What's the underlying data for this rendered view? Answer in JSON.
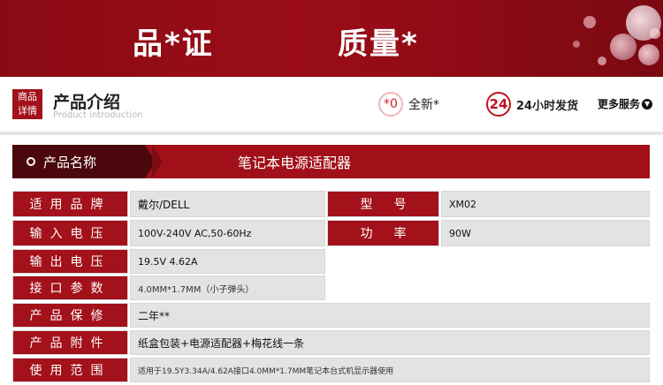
{
  "banner": {
    "left_text": "品*证",
    "right_text": "质量*"
  },
  "intro": {
    "badge_line1": "商品",
    "badge_line2": "详情",
    "title": "产品介绍",
    "subtitle": "Product introduction",
    "feature_new_icon": "*0",
    "feature_new_label": "全新*",
    "feature_ship_icon": "24",
    "feature_ship_label": "24小时发货",
    "more_label": "更多服务",
    "more_icon": "chevron-down-icon"
  },
  "product_name": {
    "label": "产品名称",
    "value": "笔记本电源适配器"
  },
  "specs": [
    {
      "label": "适用品牌",
      "value": "戴尔/DELL"
    },
    {
      "label": "输入电压",
      "value": "100V-240V AC,50-60Hz"
    },
    {
      "label": "输出电压",
      "value": "19.5V 4.62A"
    },
    {
      "label": "接口参数",
      "value": "4.0MM*1.7MM（小子弹头）"
    },
    {
      "label": "产品保修",
      "value": "二年**"
    },
    {
      "label": "产品附件",
      "value": "纸盒包装+电源适配器+梅花线一条"
    },
    {
      "label": "使用范围",
      "value": "适用于19.5Y3.34A/4.62A接口4.0MM*1.7MM笔记本台式机显示器使用"
    }
  ],
  "specs_right": [
    {
      "label": "型号",
      "value": "XM02"
    },
    {
      "label": "功率",
      "value": "90W"
    }
  ],
  "colors": {
    "banner_red": "#8a0a13",
    "label_red": "#a3111b",
    "dark_maroon": "#4b080c",
    "value_gray": "#e3e3e3"
  }
}
